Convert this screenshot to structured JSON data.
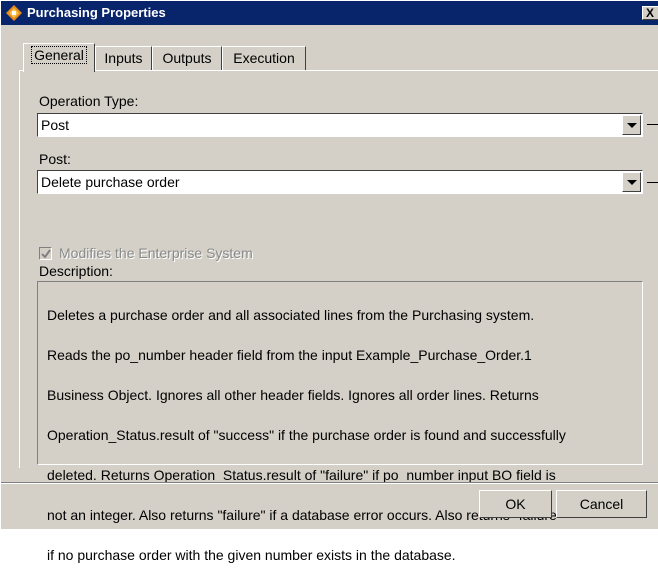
{
  "window": {
    "title": "Purchasing Properties",
    "close_label": "X",
    "title_icon": "ibm-purchasing-icon",
    "titlebar_color": "#08246b"
  },
  "tabs": [
    {
      "label": "General",
      "active": true
    },
    {
      "label": "Inputs",
      "active": false
    },
    {
      "label": "Outputs",
      "active": false
    },
    {
      "label": "Execution",
      "active": false
    }
  ],
  "general": {
    "operation_type_label": "Operation Type:",
    "operation_type_value": "Post",
    "post_label": "Post:",
    "post_value": "Delete purchase order",
    "modifies_label": "Modifies the Enterprise System",
    "modifies_checked": true,
    "modifies_enabled": false,
    "description_label": "Description:",
    "description_lines": [
      "Deletes a purchase order and all associated lines from the Purchasing system.",
      "Reads the po_number header field from the input Example_Purchase_Order.1",
      "Business Object.  Ignores all other header fields.  Ignores all order lines.  Returns",
      "Operation_Status.result of \"success\" if the purchase order is found and successfully",
      "deleted.  Returns Operation_Status.result of \"failure\" if po_number input BO field is",
      "not an integer.  Also returns \"failure\" if a database error occurs.  Also returns \"failure\"",
      "if no purchase order with the given number exists in the database."
    ]
  },
  "buttons": {
    "ok_label": "OK",
    "cancel_label": "Cancel"
  }
}
